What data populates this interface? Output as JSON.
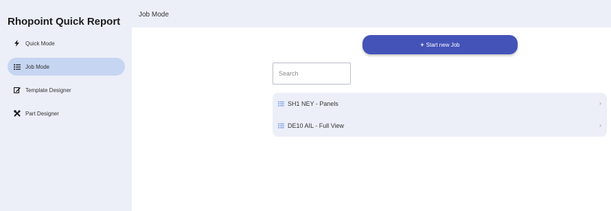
{
  "app": {
    "title": "Rhopoint Quick Report"
  },
  "sidebar": {
    "items": [
      {
        "label": "Quick Mode",
        "icon": "lightning-icon",
        "active": false
      },
      {
        "label": "Job Mode",
        "icon": "list-icon",
        "active": true
      },
      {
        "label": "Template Designer",
        "icon": "edit-icon",
        "active": false
      },
      {
        "label": "Part Designer",
        "icon": "tools-icon",
        "active": false
      }
    ]
  },
  "header": {
    "title": "Job Mode"
  },
  "main": {
    "start_button": {
      "plus": "+",
      "label": "Start new Job"
    },
    "search": {
      "placeholder": "Search",
      "value": ""
    },
    "jobs": [
      {
        "label": "SH1 NEY - Panels",
        "icon": "list-icon",
        "chevron": "›"
      },
      {
        "label": "DE10 AIL - Full View",
        "icon": "list-icon",
        "chevron": "›"
      }
    ]
  },
  "colors": {
    "accent": "#4353b8",
    "sidebar_bg": "#eceff8",
    "active_item_bg": "#c6d5f1",
    "list_icon": "#6a8ee0"
  }
}
